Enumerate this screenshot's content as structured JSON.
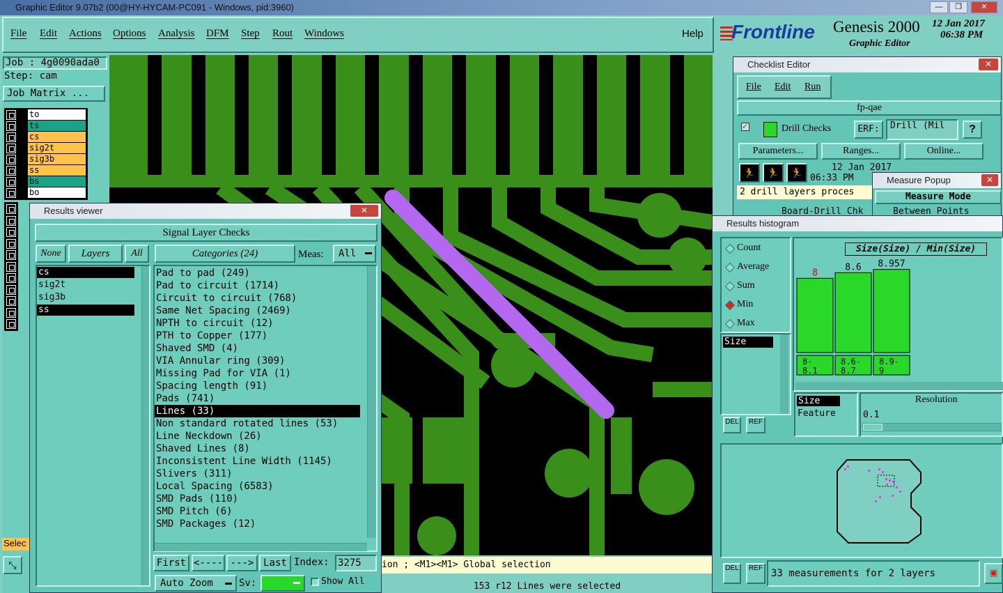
{
  "window": {
    "title": "Graphic Editor 9.07b2 (00@HY-HYCAM-PC091 - Windows, pid:3960)",
    "min": "—",
    "max": "❐",
    "close": "✕"
  },
  "menu": [
    "File",
    "Edit",
    "Actions",
    "Options",
    "Analysis",
    "DFM",
    "Step",
    "Rout",
    "Windows"
  ],
  "help": "Help",
  "brand": {
    "logo": "Frontline",
    "product": "Genesis 2000",
    "sub": "Graphic Editor",
    "date": "12 Jan 2017",
    "time": "06:38 PM"
  },
  "job": {
    "job": "Job : 4g0090ada0",
    "step": "Step: cam",
    "matrix": "Job Matrix ..."
  },
  "layers": [
    {
      "name": "to",
      "color": "#ffffff"
    },
    {
      "name": "ts",
      "color": "#19a387"
    },
    {
      "name": "cs",
      "color": "#ffc34a"
    },
    {
      "name": "sig2t",
      "color": "#ffc34a"
    },
    {
      "name": "sig3b",
      "color": "#ffc34a"
    },
    {
      "name": "ss",
      "color": "#ffc34a"
    },
    {
      "name": "bs",
      "color": "#19a387"
    },
    {
      "name": "bo",
      "color": "#ffffff"
    }
  ],
  "sel_label": "Selec",
  "results_viewer": {
    "title": "Results viewer",
    "heading": "Signal Layer Checks",
    "none": "None",
    "layers": "Layers",
    "all": "All",
    "categories": "Categories (24)",
    "meas_label": "Meas:",
    "meas_value": "All",
    "layer_list": [
      "cs",
      "sig2t",
      "sig3b",
      "ss"
    ],
    "items": [
      "Pad to pad (249)",
      "Pad to circuit (1714)",
      "Circuit to circuit (768)",
      "Same Net Spacing (2469)",
      "NPTH to circuit (12)",
      "PTH to Copper (177)",
      "Shaved SMD (4)",
      "VIA Annular ring (309)",
      "Missing Pad for VIA (1)",
      "Spacing length (91)",
      "Pads (741)",
      "Lines (33)",
      "Non standard rotated lines (53)",
      "Line Neckdown (26)",
      "Shaved Lines (8)",
      "Inconsistent Line Width (1145)",
      "Slivers (311)",
      "Local Spacing (6583)",
      "SMD Pads (110)",
      "SMD Pitch (6)",
      "SMD Packages (12)"
    ],
    "first": "First",
    "prev": "<----",
    "next": "--->",
    "last": "Last",
    "index_label": "Index:",
    "index_value": "3275",
    "auto_zoom": "Auto Zoom",
    "sv": "Sv:",
    "show_all": "Show All"
  },
  "status": {
    "line1": "ion ; <M1><M1> Global selection",
    "line2": "153 r12 Lines were selected"
  },
  "checklist": {
    "title": "Checklist Editor",
    "menu": [
      "File",
      "Edit",
      "Run"
    ],
    "name": "fp-qae",
    "check": "Drill Checks",
    "erf": "ERF:",
    "erf_value": "Drill (Mil",
    "help": "?",
    "parameters": "Parameters...",
    "ranges": "Ranges...",
    "online": "Online...",
    "date": "12 Jan 2017",
    "time": "06:33 PM",
    "msg": "2 drill layers proces",
    "row2": "Board-Drill Chk"
  },
  "measure": {
    "title": "Measure Popup",
    "mode": "Measure Mode",
    "between": "Between Points"
  },
  "histogram": {
    "title": "Results histogram",
    "options": [
      "Count",
      "Average",
      "Sum",
      "Min",
      "Max"
    ],
    "selected_option": "Min",
    "field": "Size",
    "chart_title": "Size(Size) / Min(Size)",
    "del": "DEL",
    "ref": "REF",
    "size": "Size",
    "feature": "Feature",
    "resolution": "Resolution",
    "res_value": "0.1",
    "summary": "33 measurements for 2 layers"
  },
  "chart_data": {
    "type": "bar",
    "title": "Size(Size) / Min(Size)",
    "categories": [
      "8-8.1",
      "8.6-8.7",
      "8.9-9"
    ],
    "values": [
      8,
      8.6,
      8.957
    ],
    "labels": [
      "8",
      "8.6",
      "8.957"
    ],
    "ylim": [
      0,
      9
    ]
  }
}
